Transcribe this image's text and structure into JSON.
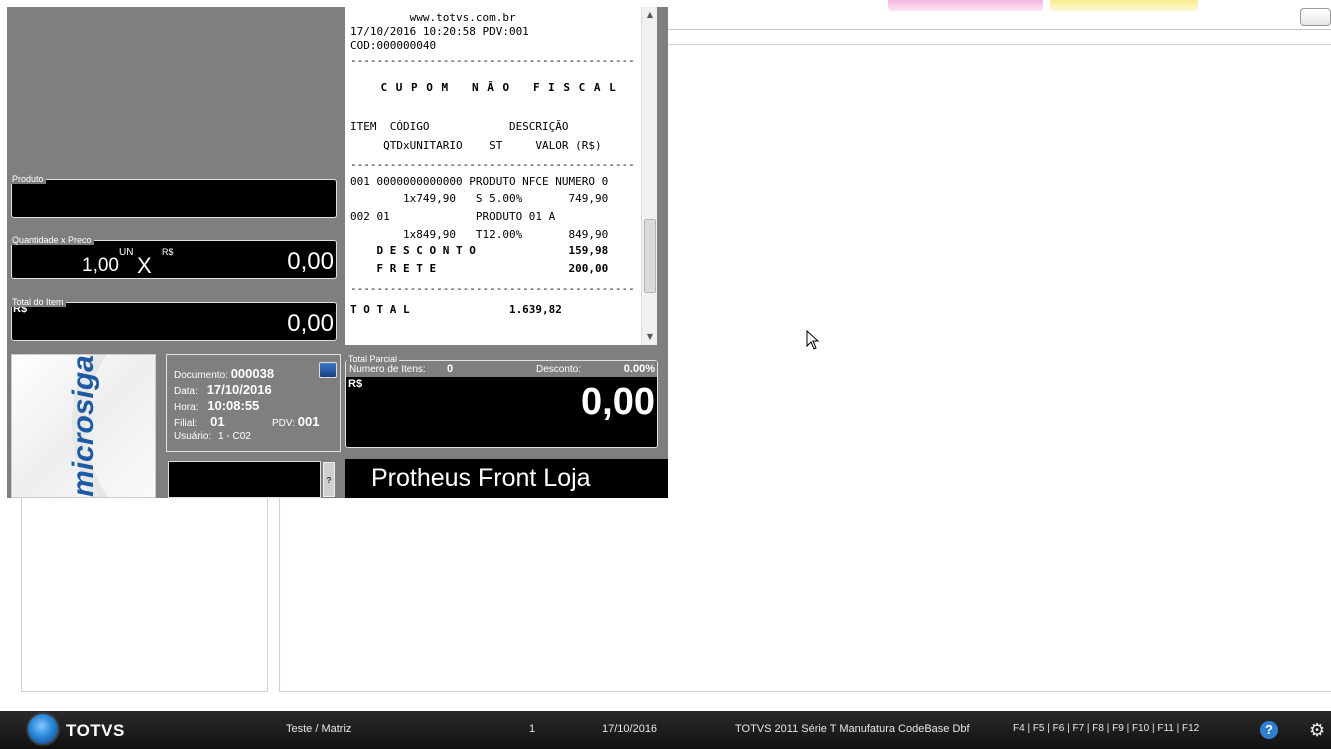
{
  "background": {
    "tab_pink_label": "",
    "tab_yellow_label": "",
    "close_button_label": ""
  },
  "pos": {
    "produto": {
      "label": "Produto",
      "value": ""
    },
    "quantidade_preco": {
      "label": "Quantidade x Preco",
      "quantity": "1,00",
      "unit": "UN",
      "times": "X",
      "currency": "R$",
      "price": "0,00"
    },
    "total_item": {
      "label": "Total do Item",
      "currency": "R$",
      "value": "0,00"
    },
    "brand": "microsiga",
    "document": {
      "documento_label": "Documento:",
      "documento_value": "000038",
      "data_label": "Data:",
      "data_value": "17/10/2016",
      "hora_label": "Hora:",
      "hora_value": "10:08:55",
      "filial_label": "Filial:",
      "filial_value": "01",
      "pdv_label": "PDV:",
      "pdv_value": "001",
      "usuario_label": "Usuário:",
      "usuario_value": "1 - C02"
    },
    "input_button": "?",
    "total_parcial": {
      "label": "Total Parcial",
      "itens_label": "Numero de Itens:",
      "itens_value": "0",
      "desconto_label": "Desconto:",
      "desconto_value": "0.00%",
      "currency": "R$",
      "value": "0,00"
    },
    "footer_title": "Protheus Front Loja",
    "receipt_lines": [
      "         www.totvs.com.br",
      "17/10/2016 10:20:58 PDV:001",
      "COD:000000040",
      "-------------------------------------------",
      "    C U P O M   N Ã O   F I S C A L",
      "",
      "ITEM  CÓDIGO            DESCRIÇÃO",
      "     QTDxUNITARIO    ST     VALOR (R$)",
      "-------------------------------------------",
      "001 0000000000000 PRODUTO NFCE NUMERO 0",
      "        1x749,90   S 5.00%       749,90",
      "002 01             PRODUTO 01 A",
      "        1x849,90   T12.00%       849,90",
      "    D E S C O N T O              159,98",
      "    F R E T E                    200,00",
      "-------------------------------------------",
      "T O T A L               1.639,82"
    ]
  },
  "taskbar": {
    "brand": "TOTVS",
    "empresa": "Teste / Matriz",
    "modulo": "1",
    "data": "17/10/2016",
    "versao": "TOTVS 2011 Série T Manufatura CodeBase Dbf",
    "atalhos": "F4 | F5 | F6 | F7 | F8 | F9 | F10 | F11 | F12",
    "help_glyph": "?",
    "gear_glyph": "⚙"
  },
  "colors": {
    "pos_gray": "#7f7f7f",
    "field_black": "#000000",
    "brand_blue": "#1d5aa6",
    "taskbar": "#1a1a1a"
  }
}
